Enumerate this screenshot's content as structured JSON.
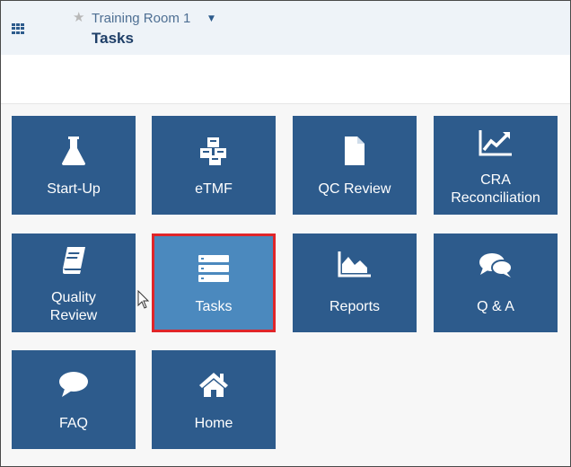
{
  "header": {
    "room_name": "Training Room 1",
    "page_title": "Tasks"
  },
  "tiles": [
    {
      "label": "Start-Up",
      "icon": "flask-icon"
    },
    {
      "label": "eTMF",
      "icon": "cubes-icon"
    },
    {
      "label": "QC Review",
      "icon": "document-icon"
    },
    {
      "label_line1": "CRA",
      "label_line2": "Reconciliation",
      "icon": "line-chart-icon"
    },
    {
      "label_line1": "Quality",
      "label_line2": "Review",
      "icon": "book-icon"
    },
    {
      "label": "Tasks",
      "icon": "tasks-icon",
      "selected": true
    },
    {
      "label": "Reports",
      "icon": "area-chart-icon"
    },
    {
      "label": "Q & A",
      "icon": "chat-bubbles-icon"
    },
    {
      "label": "FAQ",
      "icon": "speech-bubble-icon"
    },
    {
      "label": "Home",
      "icon": "home-icon"
    }
  ],
  "colors": {
    "tile": "#2d5b8c",
    "tile_selected": "#4b89be",
    "selection_border": "#e0262a",
    "header_bg": "#eef3f8"
  }
}
